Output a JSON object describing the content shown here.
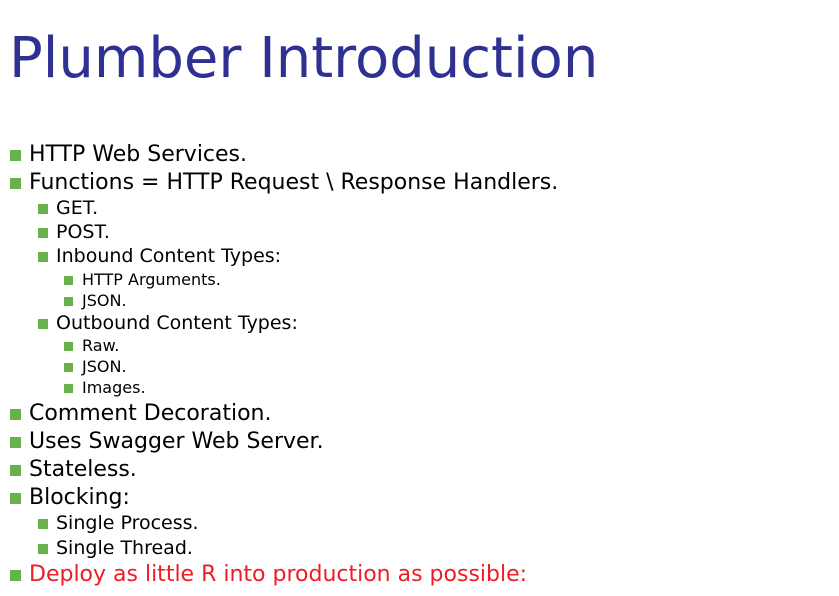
{
  "slide": {
    "title": "Plumber Introduction",
    "bullet_color": "#6ab04c",
    "title_color": "#2e3192",
    "highlight_color": "#ee1c24",
    "bullets": [
      {
        "text": "HTTP Web Services."
      },
      {
        "text": "Functions = HTTP Request \\ Response Handlers."
      },
      {
        "text": "GET."
      },
      {
        "text": "POST."
      },
      {
        "text": "Inbound Content Types:"
      },
      {
        "text": "HTTP Arguments."
      },
      {
        "text": "JSON."
      },
      {
        "text": "Outbound Content Types:"
      },
      {
        "text": "Raw."
      },
      {
        "text": "JSON."
      },
      {
        "text": "Images."
      },
      {
        "text": "Comment Decoration."
      },
      {
        "text": "Uses Swagger Web Server."
      },
      {
        "text": "Stateless."
      },
      {
        "text": "Blocking:"
      },
      {
        "text": "Single Process."
      },
      {
        "text": "Single Thread."
      },
      {
        "text": "Deploy as little R into production as possible:"
      }
    ]
  }
}
